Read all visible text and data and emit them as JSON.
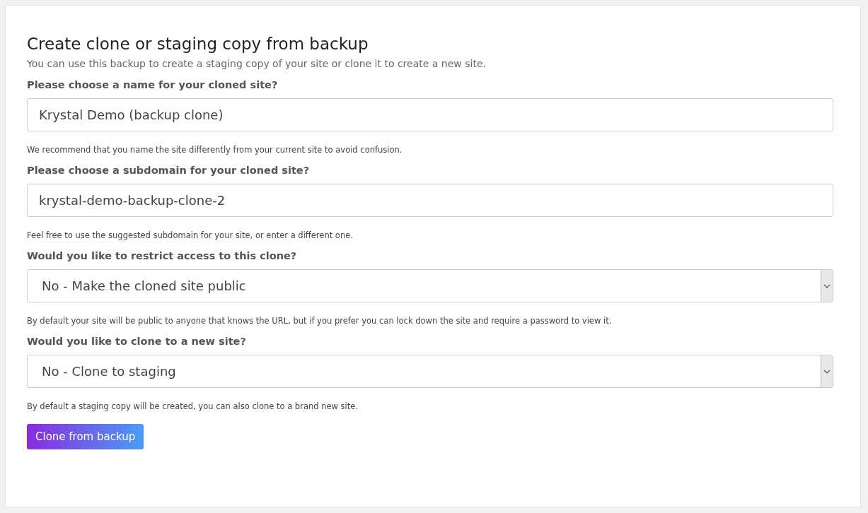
{
  "title": "Create clone or staging copy from backup",
  "subtitle": "You can use this backup to create a staging copy of your site or clone it to create a new site.",
  "fields": [
    {
      "kind": "text",
      "label": "Please choose a name for your cloned site?",
      "value": "Krystal Demo (backup clone)",
      "hint": "We recommend that you name the site differently from your current site to avoid confusion."
    },
    {
      "kind": "text",
      "label": "Please choose a subdomain for your cloned site?",
      "value": "krystal-demo-backup-clone-2",
      "hint": "Feel free to use the suggested subdomain for your site, or enter a different one."
    },
    {
      "kind": "select",
      "label": "Would you like to restrict access to this clone?",
      "value": "No - Make the cloned site public",
      "hint": "By default your site will be public to anyone that knows the URL, but if you prefer you can lock down the site and require a password to view it."
    },
    {
      "kind": "select",
      "label": "Would you like to clone to a new site?",
      "value": "No - Clone to staging",
      "hint": "By default a staging copy will be created, you can also clone to a brand new site."
    }
  ],
  "button": "Clone from backup"
}
